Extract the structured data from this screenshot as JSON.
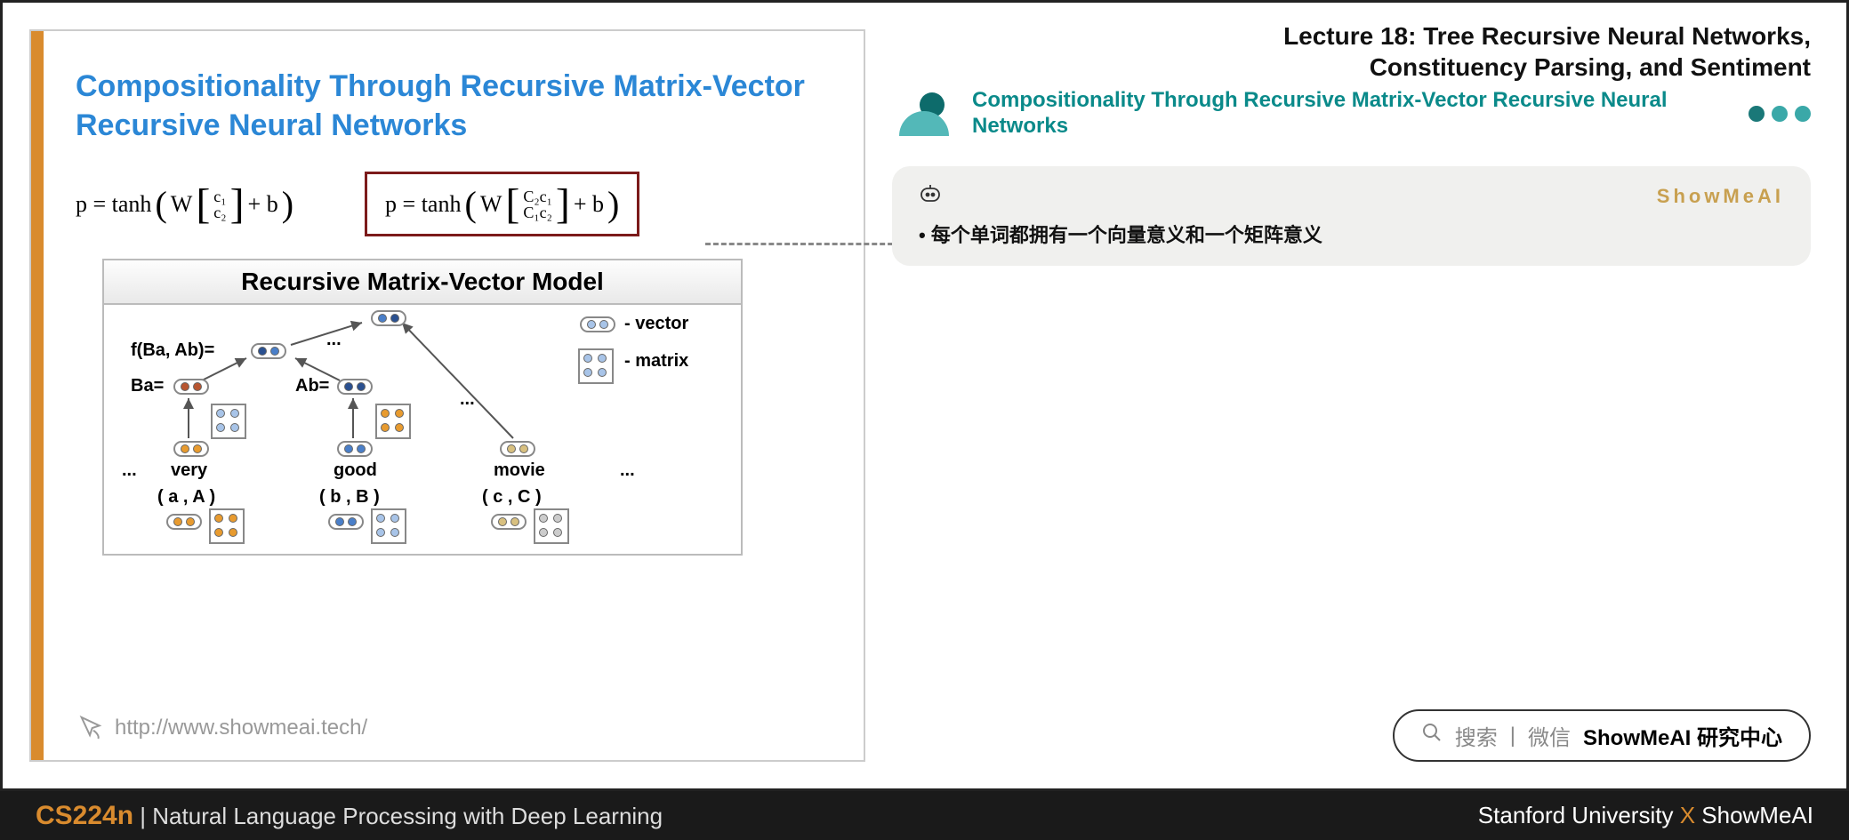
{
  "slide": {
    "title": "Compositionality Through Recursive Matrix-Vector Recursive Neural Networks",
    "formula1_pre": "p  =  tanh",
    "formula1_W": "W",
    "formula1_c1": "c₁",
    "formula1_c2": "c₂",
    "formula1_post": "+ b",
    "formula2_pre": "p  =  tanh",
    "formula2_W": "W",
    "formula2_r1": "C₂c₁",
    "formula2_r2": "C₁c₂",
    "formula2_post": " + b",
    "diagram_title": "Recursive Matrix-Vector Model",
    "fBaAb": "f(Ba, Ab)=",
    "Ba": "Ba=",
    "Ab": "Ab=",
    "very": "very",
    "good": "good",
    "movie": "movie",
    "pair_a": "( a  ,  A )",
    "pair_b": "( b  ,  B )",
    "pair_c": "( c  ,  C )",
    "legend_vector": "- vector",
    "legend_matrix": "- matrix",
    "ellipsis": "...",
    "footer_url": "http://www.showmeai.tech/"
  },
  "right": {
    "lecture_title_l1": "Lecture 18: Tree Recursive Neural Networks,",
    "lecture_title_l2": "Constituency Parsing, and Sentiment",
    "section_title": "Compositionality Through Recursive Matrix-Vector Recursive Neural Networks",
    "brand": "ShowMeAI",
    "note_text": "每个单词都拥有一个向量意义和一个矩阵意义"
  },
  "search": {
    "label_search": "搜索",
    "label_wechat": "微信",
    "label_center": "ShowMeAI 研究中心"
  },
  "footer": {
    "course_code": "CS224n",
    "course_name": "Natural Language Processing with Deep Learning",
    "stanford": "Stanford University",
    "x": "X",
    "showmeai": "ShowMeAI"
  }
}
